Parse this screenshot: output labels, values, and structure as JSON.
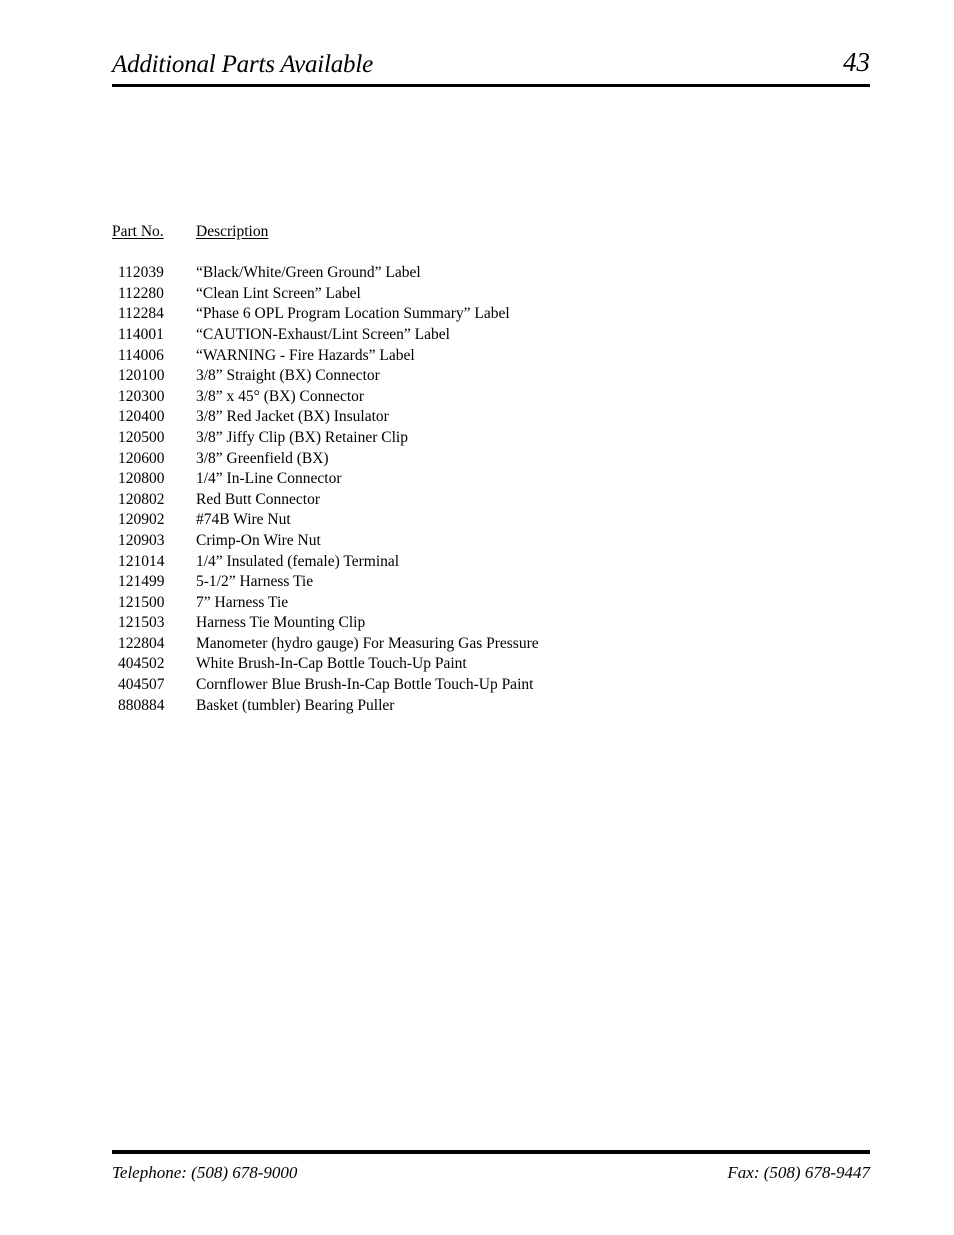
{
  "header": {
    "title": "Additional Parts Available",
    "page_number": "43"
  },
  "table": {
    "columns": {
      "part_no": "Part No.",
      "description": "Description"
    },
    "rows": [
      {
        "part_no": "112039",
        "description": "“Black/White/Green Ground” Label"
      },
      {
        "part_no": "112280",
        "description": "“Clean Lint Screen” Label"
      },
      {
        "part_no": "112284",
        "description": "“Phase 6 OPL Program Location Summary” Label"
      },
      {
        "part_no": "114001",
        "description": "“CAUTION-Exhaust/Lint Screen” Label"
      },
      {
        "part_no": "114006",
        "description": "“WARNING - Fire Hazards” Label"
      },
      {
        "part_no": "120100",
        "description": "3/8” Straight (BX) Connector"
      },
      {
        "part_no": "120300",
        "description": "3/8” x 45° (BX) Connector"
      },
      {
        "part_no": "120400",
        "description": "3/8” Red Jacket (BX) Insulator"
      },
      {
        "part_no": "120500",
        "description": "3/8” Jiffy Clip (BX) Retainer Clip"
      },
      {
        "part_no": "120600",
        "description": "3/8” Greenfield (BX)"
      },
      {
        "part_no": "120800",
        "description": "1/4” In-Line Connector"
      },
      {
        "part_no": "120802",
        "description": "Red Butt Connector"
      },
      {
        "part_no": "120902",
        "description": "#74B Wire Nut"
      },
      {
        "part_no": "120903",
        "description": "Crimp-On Wire Nut"
      },
      {
        "part_no": "121014",
        "description": "1/4” Insulated (female) Terminal"
      },
      {
        "part_no": "121499",
        "description": "5-1/2” Harness Tie"
      },
      {
        "part_no": "121500",
        "description": "7” Harness Tie"
      },
      {
        "part_no": "121503",
        "description": "Harness Tie Mounting Clip"
      },
      {
        "part_no": "122804",
        "description": "Manometer (hydro gauge) For Measuring Gas Pressure"
      },
      {
        "part_no": "404502",
        "description": "White Brush-In-Cap Bottle Touch-Up Paint"
      },
      {
        "part_no": "404507",
        "description": "Cornflower Blue Brush-In-Cap Bottle Touch-Up Paint"
      },
      {
        "part_no": "880884",
        "description": "Basket (tumbler) Bearing Puller"
      }
    ]
  },
  "footer": {
    "telephone": "Telephone: (508) 678-9000",
    "fax": "Fax: (508) 678-9447"
  }
}
